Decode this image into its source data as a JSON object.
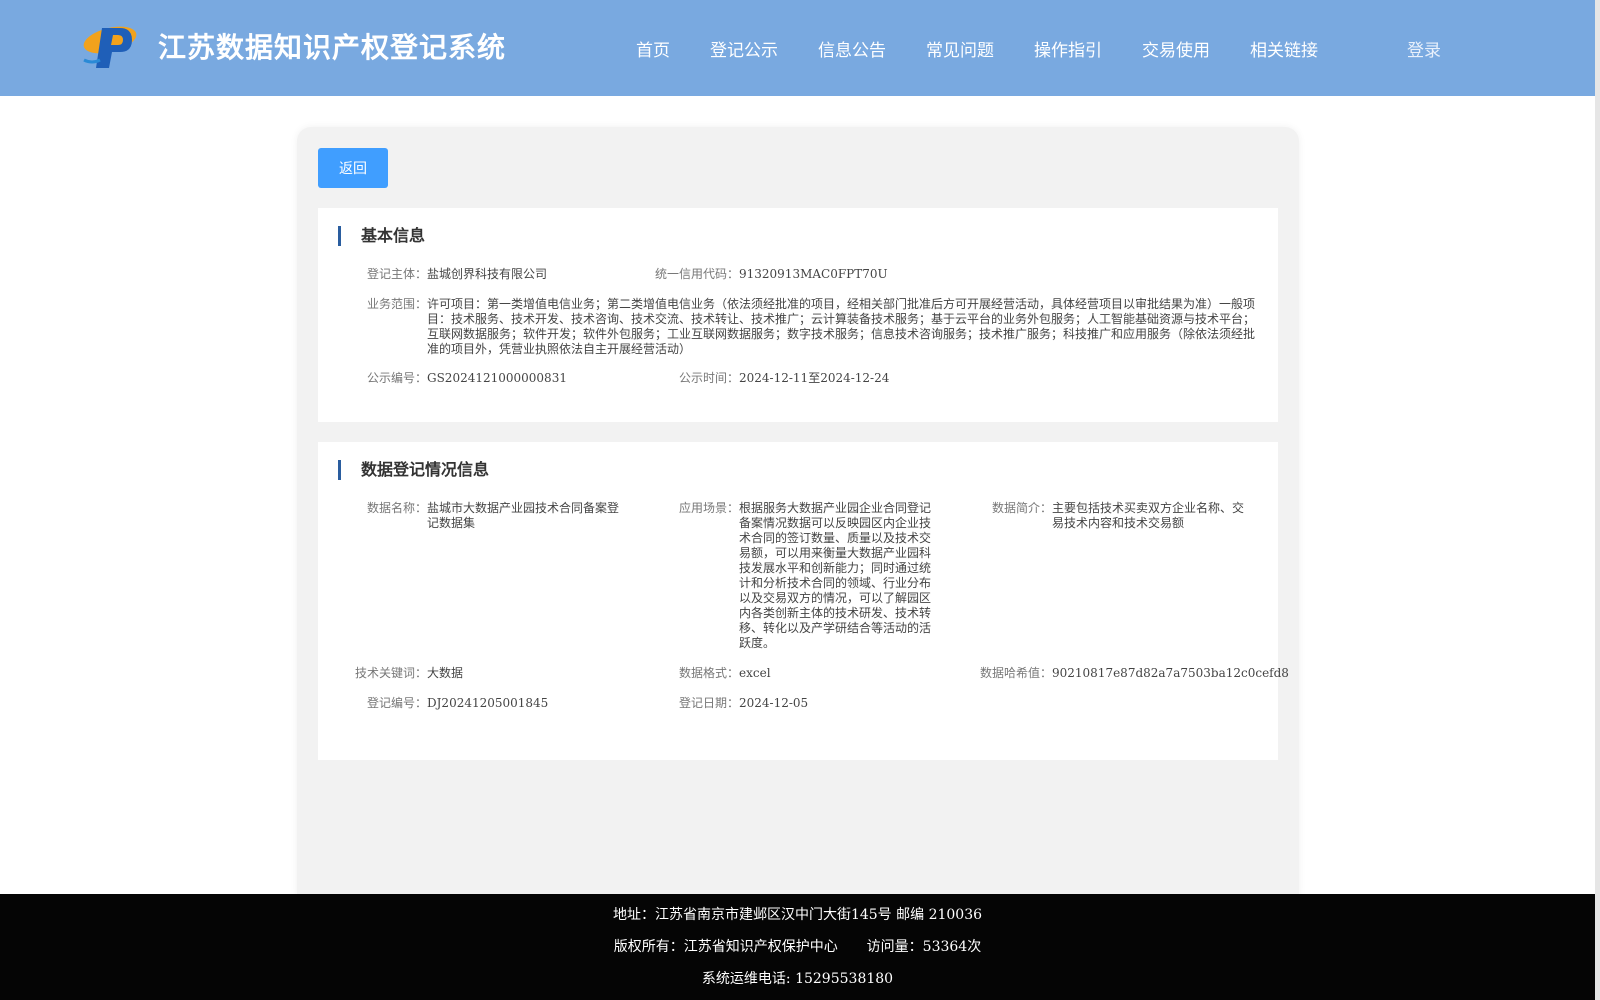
{
  "header": {
    "site_title": "江苏数据知识产权登记系统",
    "logo_icon": "ip-logo-icon",
    "nav": [
      "首页",
      "登记公示",
      "信息公告",
      "常见问题",
      "操作指引",
      "交易使用",
      "相关链接"
    ],
    "login": "登录"
  },
  "back_button": "返回",
  "basic_info": {
    "title": "基本信息",
    "entity_label": "登记主体：",
    "entity": "盐城创界科技有限公司",
    "credit_code_label": "统一信用代码：",
    "credit_code": "91320913MAC0FPT70U",
    "business_scope_label": "业务范围：",
    "business_scope": "许可项目：第一类增值电信业务；第二类增值电信业务（依法须经批准的项目，经相关部门批准后方可开展经营活动，具体经营项目以审批结果为准）一般项目：技术服务、技术开发、技术咨询、技术交流、技术转让、技术推广；云计算装备技术服务；基于云平台的业务外包服务；人工智能基础资源与技术平台；互联网数据服务；软件开发；软件外包服务；工业互联网数据服务；数字技术服务；信息技术咨询服务；技术推广服务；科技推广和应用服务（除依法须经批准的项目外，凭营业执照依法自主开展经营活动）",
    "notice_no_label": "公示编号：",
    "notice_no": "GS2024121000000831",
    "notice_time_label": "公示时间：",
    "notice_time": "2024-12-11至2024-12-24"
  },
  "data_info": {
    "title": "数据登记情况信息",
    "name_label": "数据名称：",
    "name": "盐城市大数据产业园技术合同备案登记数据集",
    "scenario_label": "应用场景：",
    "scenario": "根据服务大数据产业园企业合同登记备案情况数据可以反映园区内企业技术合同的签订数量、质量以及技术交易额，可以用来衡量大数据产业园科技发展水平和创新能力；同时通过统计和分析技术合同的领域、行业分布以及交易双方的情况，可以了解园区内各类创新主体的技术研发、技术转移、转化以及产学研结合等活动的活跃度。",
    "summary_label": "数据简介：",
    "summary": "主要包括技术买卖双方企业名称、交易技术内容和技术交易额",
    "keywords_label": "技术关键词：",
    "keywords": "大数据",
    "format_label": "数据格式：",
    "format": "excel",
    "hash_label": "数据哈希值：",
    "hash": "90210817e87d82a7a7503ba12c0cefd8",
    "reg_no_label": "登记编号：",
    "reg_no": "DJ20241205001845",
    "reg_date_label": "登记日期：",
    "reg_date": "2024-12-05"
  },
  "footer": {
    "address": "地址：江苏省南京市建邺区汉中门大街145号 邮编 210036",
    "copyright": "版权所有：江苏省知识产权保护中心",
    "visits": "访问量：53364次",
    "phone": "系统运维电话: 15295538180"
  }
}
